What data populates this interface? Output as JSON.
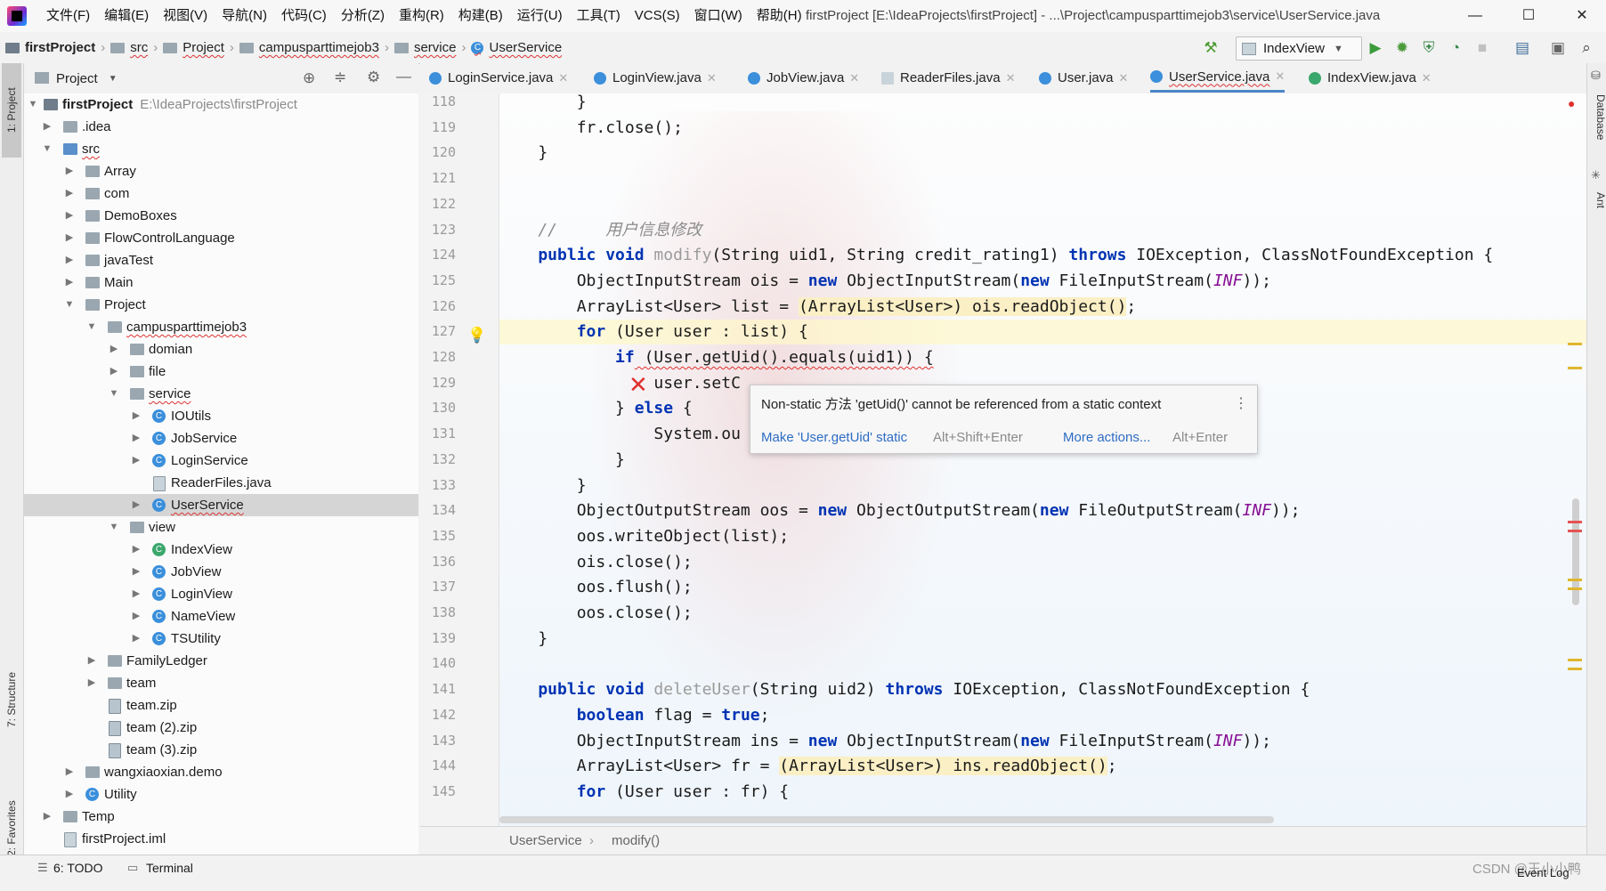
{
  "menu": [
    "文件(F)",
    "编辑(E)",
    "视图(V)",
    "导航(N)",
    "代码(C)",
    "分析(Z)",
    "重构(R)",
    "构建(B)",
    "运行(U)",
    "工具(T)",
    "VCS(S)",
    "窗口(W)",
    "帮助(H)"
  ],
  "window_title": "firstProject [E:\\IdeaProjects\\firstProject] - ...\\Project\\campusparttimejob3\\service\\UserService.java",
  "window_controls": {
    "minimize": "—",
    "maximize": "☐",
    "close": "✕"
  },
  "navbar": {
    "crumbs": [
      "firstProject",
      "src",
      "Project",
      "campusparttimejob3",
      "service",
      "UserService"
    ],
    "run_config": "IndexView"
  },
  "left_strip": {
    "project_tab": "1: Project",
    "structure_tab": "7: Structure",
    "favorites_tab": "2: Favorites"
  },
  "project_panel": {
    "title": "Project"
  },
  "tree": [
    {
      "label": "firstProject",
      "path": "E:\\IdeaProjects\\firstProject"
    },
    {
      "label": ".idea"
    },
    {
      "label": "src"
    },
    {
      "label": "Array"
    },
    {
      "label": "com"
    },
    {
      "label": "DemoBoxes"
    },
    {
      "label": "FlowControlLanguage"
    },
    {
      "label": "javaTest"
    },
    {
      "label": "Main"
    },
    {
      "label": "Project"
    },
    {
      "label": "campusparttimejob3"
    },
    {
      "label": "domian"
    },
    {
      "label": "file"
    },
    {
      "label": "service"
    },
    {
      "label": "IOUtils"
    },
    {
      "label": "JobService"
    },
    {
      "label": "LoginService"
    },
    {
      "label": "ReaderFiles.java"
    },
    {
      "label": "UserService"
    },
    {
      "label": "view"
    },
    {
      "label": "IndexView"
    },
    {
      "label": "JobView"
    },
    {
      "label": "LoginView"
    },
    {
      "label": "NameView"
    },
    {
      "label": "TSUtility"
    },
    {
      "label": "FamilyLedger"
    },
    {
      "label": "team"
    },
    {
      "label": "team.zip"
    },
    {
      "label": "team (2).zip"
    },
    {
      "label": "team (3).zip"
    },
    {
      "label": "wangxiaoxian.demo"
    },
    {
      "label": "Utility"
    },
    {
      "label": "Temp"
    },
    {
      "label": "firstProject.iml"
    }
  ],
  "editor_tabs": [
    "LoginService.java",
    "LoginView.java",
    "JobView.java",
    "ReaderFiles.java",
    "User.java",
    "UserService.java",
    "IndexView.java"
  ],
  "line_numbers": [
    "118",
    "119",
    "120",
    "121",
    "122",
    "123",
    "124",
    "125",
    "126",
    "127",
    "128",
    "129",
    "130",
    "131",
    "132",
    "133",
    "134",
    "135",
    "136",
    "137",
    "138",
    "139",
    "140",
    "141",
    "142",
    "143",
    "144",
    "145"
  ],
  "code": {
    "l118": "        }",
    "l119": "        fr.close();",
    "l120": "    }",
    "l123": "    //     用户信息修改",
    "l124_a": "    public void ",
    "l124_b": "modify",
    "l124_c": "(String uid1, String credit_rating1) ",
    "l124_d": "throws",
    "l124_e": " IOException, ClassNotFoundException {",
    "l125_a": "        ObjectInputStream ois = ",
    "l125_b": "new",
    "l125_c": " ObjectInputStream(",
    "l125_d": "new",
    "l125_e": " FileInputStream(",
    "l125_f": "INF",
    "l125_g": "));",
    "l126_a": "        ArrayList<User> list = ",
    "l126_b": "(ArrayList<User>) ois.readObject()",
    "l126_c": ";",
    "l127_a": "        ",
    "l127_b": "for",
    "l127_c": " (User user : list) {",
    "l128_a": "            ",
    "l128_b": "if",
    "l128_c": " (User.getUid().equals(uid1)) {",
    "l129": "                user.setC",
    "l130_a": "            } ",
    "l130_b": "else",
    "l130_c": " {",
    "l131": "                System.ou",
    "l132": "            }",
    "l133": "        }",
    "l134_a": "        ObjectOutputStream oos = ",
    "l134_b": "new",
    "l134_c": " ObjectOutputStream(",
    "l134_d": "new",
    "l134_e": " FileOutputStream(",
    "l134_f": "INF",
    "l134_g": "));",
    "l135": "        oos.writeObject(list);",
    "l136": "        ois.close();",
    "l137": "        oos.flush();",
    "l138": "        oos.close();",
    "l139": "    }",
    "l141_a": "    public void ",
    "l141_b": "deleteUser",
    "l141_c": "(String uid2) ",
    "l141_d": "throws",
    "l141_e": " IOException, ClassNotFoundException {",
    "l142_a": "        ",
    "l142_b": "boolean",
    "l142_c": " flag = ",
    "l142_d": "true",
    "l142_e": ";",
    "l143_a": "        ObjectInputStream ins = ",
    "l143_b": "new",
    "l143_c": " ObjectInputStream(",
    "l143_d": "new",
    "l143_e": " FileInputStream(",
    "l143_f": "INF",
    "l143_g": "));",
    "l144_a": "        ArrayList<User> fr = ",
    "l144_b": "(ArrayList<User>) ins.readObject()",
    "l144_c": ";",
    "l145_a": "        ",
    "l145_b": "for",
    "l145_c": " (User user : fr) {"
  },
  "popup": {
    "message": "Non-static 方法 'getUid()' cannot be referenced from a static context",
    "fix": "Make 'User.getUid' static",
    "fix_shortcut": "Alt+Shift+Enter",
    "more": "More actions...",
    "more_shortcut": "Alt+Enter"
  },
  "editor_breadcrumb": [
    "UserService",
    "modify()"
  ],
  "right_strip": {
    "database": "Database",
    "ant": "Ant"
  },
  "statusbar": {
    "todo": "6: TODO",
    "terminal": "Terminal",
    "event_log": "Event Log",
    "watermark": "CSDN @王小小鸭"
  },
  "colors": {
    "keyword": "#0033b3",
    "comment": "#8c8c8c",
    "constant": "#871094",
    "link": "#2d6cc4",
    "selection": "#d5d5d5"
  }
}
